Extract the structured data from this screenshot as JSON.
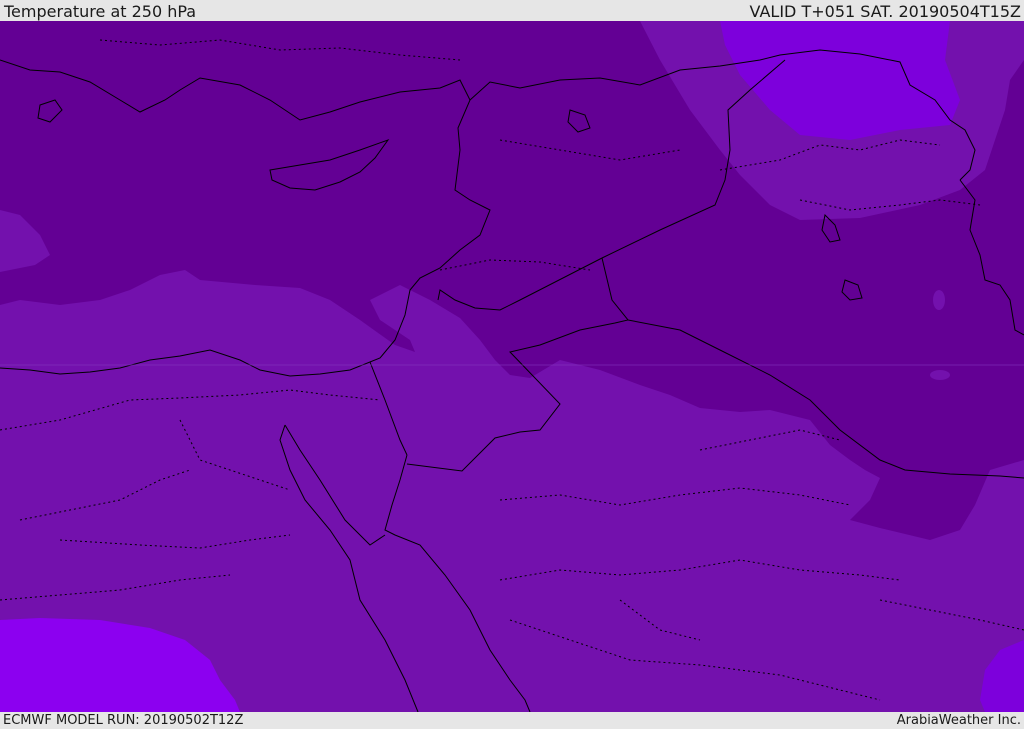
{
  "header": {
    "title": "Temperature at 250 hPa",
    "valid": "VALID T+051 SAT. 20190504T15Z"
  },
  "footer": {
    "model_run": "ECMWF MODEL RUN: 20190502T12Z",
    "credit": "ArabiaWeather Inc."
  },
  "map": {
    "field": "temperature",
    "pressure_level": "250 hPa",
    "region": "Eastern Mediterranean and Middle East",
    "colors": {
      "coldest_band": "#630094",
      "cold_band": "#7311AD",
      "warm_band": "#7D00DC",
      "warmest_band": "#8C00F0",
      "coastline": "#000000",
      "border": "#000000"
    }
  }
}
